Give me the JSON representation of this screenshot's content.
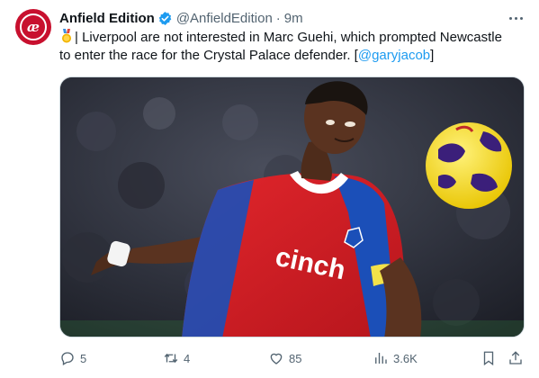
{
  "author": {
    "display_name": "Anfield Edition",
    "handle": "@AnfieldEdition",
    "separator": "·",
    "time": "9m",
    "avatar_text": "æ"
  },
  "tweet": {
    "line1": "| Liverpool are not interested in Marc Guehi, which prompted Newcastle",
    "line2_text": "to enter the race for the Crystal Palace defender. [",
    "mention": "@garyjacob",
    "line2_end": "]"
  },
  "media": {
    "shirt_sponsor": "cinch"
  },
  "actions": {
    "replies": "5",
    "reposts": "4",
    "likes": "85",
    "views": "3.6K"
  },
  "colors": {
    "accent": "#1d9bf0",
    "avatar_bg": "#c8102e",
    "muted_text": "#536471"
  }
}
